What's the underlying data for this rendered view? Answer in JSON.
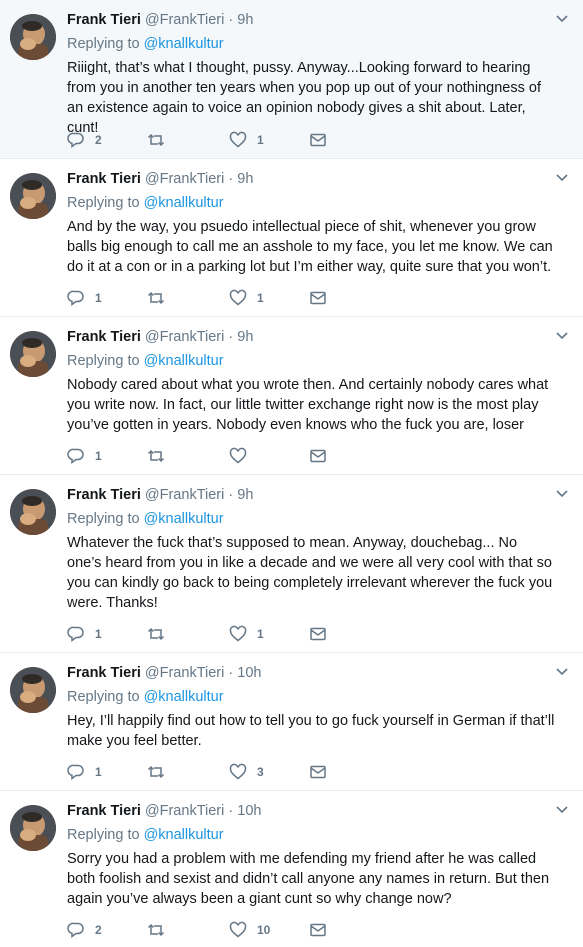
{
  "tweets": [
    {
      "name": "Frank Tieri",
      "handle": "@FrankTieri",
      "dot": "·",
      "time": "9h",
      "replying_prefix": "Replying to ",
      "replying_to": "@knallkultur",
      "text": "Riiight, that’s what I thought, pussy. Anyway...Looking forward to hearing from you in another ten years when you pop up out of your nothingness of an existence again to voice an opinion nobody gives a shit about. Later, cunt!",
      "replies": "2",
      "retweets": "",
      "likes": "1"
    },
    {
      "name": "Frank Tieri",
      "handle": "@FrankTieri",
      "dot": "·",
      "time": "9h",
      "replying_prefix": "Replying to ",
      "replying_to": "@knallkultur",
      "text": "And by the way, you psuedo intellectual piece of shit, whenever you grow balls big enough to call me an asshole to my face, you let me know. We can do it at a con or in a parking lot but I’m either way, quite sure that you won’t.",
      "replies": "1",
      "retweets": "",
      "likes": "1"
    },
    {
      "name": "Frank Tieri",
      "handle": "@FrankTieri",
      "dot": "·",
      "time": "9h",
      "replying_prefix": "Replying to ",
      "replying_to": "@knallkultur",
      "text": "Nobody cared about what you wrote then. And certainly nobody cares what you write now. In fact, our little twitter exchange right now is the most play you’ve gotten in years. Nobody even knows who the fuck you are, loser",
      "replies": "1",
      "retweets": "",
      "likes": ""
    },
    {
      "name": "Frank Tieri",
      "handle": "@FrankTieri",
      "dot": "·",
      "time": "9h",
      "replying_prefix": "Replying to ",
      "replying_to": "@knallkultur",
      "text": "Whatever the fuck that’s supposed to mean. Anyway, douchebag... No one’s heard from you in like a decade and we were all very cool with that so you can kindly go back to being completely irrelevant wherever the fuck you were. Thanks!",
      "replies": "1",
      "retweets": "",
      "likes": "1"
    },
    {
      "name": "Frank Tieri",
      "handle": "@FrankTieri",
      "dot": "·",
      "time": "10h",
      "replying_prefix": "Replying to ",
      "replying_to": "@knallkultur",
      "text": "Hey, I’ll happily find out how to tell you to go fuck yourself in German if that’ll make you feel better.",
      "replies": "1",
      "retweets": "",
      "likes": "3"
    },
    {
      "name": "Frank Tieri",
      "handle": "@FrankTieri",
      "dot": "·",
      "time": "10h",
      "replying_prefix": "Replying to ",
      "replying_to": "@knallkultur",
      "text": "Sorry you had a problem with me defending my friend after he was called both foolish and sexist and didn’t call anyone any names in return. But then again you’ve always been a giant cunt so why change now?",
      "replies": "2",
      "retweets": "",
      "likes": "10"
    }
  ],
  "icons": {
    "reply": "reply-icon",
    "retweet": "retweet-icon",
    "like": "heart-icon",
    "dm": "envelope-icon",
    "menu": "chevron-down-icon"
  },
  "colors": {
    "text": "#14171a",
    "muted": "#657786",
    "link": "#1b95e0",
    "highlight_bg": "#f5f8fa",
    "divider": "#e6ecf0"
  }
}
